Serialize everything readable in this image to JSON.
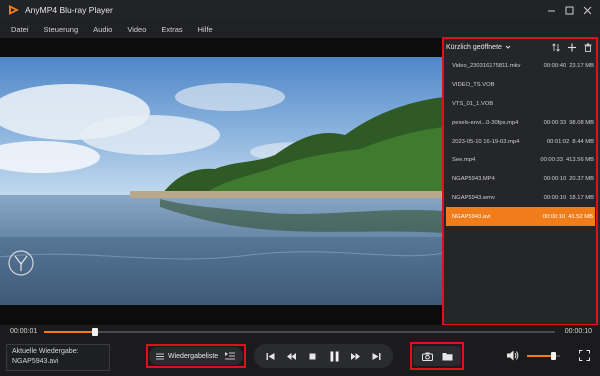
{
  "app": {
    "title": "AnyMP4 Blu-ray Player",
    "accent": "#f07d1a",
    "highlight": "#e0101c"
  },
  "window_controls": [
    "minimize-icon",
    "maximize-icon",
    "close-icon"
  ],
  "menu": [
    "Datei",
    "Steuerung",
    "Audio",
    "Video",
    "Extras",
    "Hilfe"
  ],
  "playlist": {
    "title": "Kürzlich geöffnete",
    "tools": [
      "sort-icon",
      "add-icon",
      "trash-icon"
    ],
    "items": [
      {
        "name": "Video_230316175811.mkv",
        "duration": "00:00:40",
        "size": "23.17 MB"
      },
      {
        "name": "VIDEO_TS.VOB",
        "duration": "",
        "size": ""
      },
      {
        "name": "VTS_01_1.VOB",
        "duration": "",
        "size": ""
      },
      {
        "name": "pexels-envi...0-30fps.mp4",
        "duration": "00:00:33",
        "size": "98.08 MB"
      },
      {
        "name": "2023-05-10 16-19-03.mp4",
        "duration": "00:01:02",
        "size": "8.44 MB"
      },
      {
        "name": "See.mp4",
        "duration": "00:00:33",
        "size": "413.56 MB"
      },
      {
        "name": "NGAP5943.MP4",
        "duration": "00:00:10",
        "size": "20.37 MB"
      },
      {
        "name": "NGAP5943.wmv",
        "duration": "00:00:10",
        "size": "18.17 MB"
      },
      {
        "name": "NGAP5943.avi",
        "duration": "00:00:10",
        "size": "41.52 MB",
        "active": true
      }
    ]
  },
  "progress": {
    "current": "00:00:01",
    "total": "00:00:10",
    "fraction": 0.1
  },
  "now_playing": {
    "label": "Aktuelle Wiedergabe:",
    "file": "NGAP5943.avi"
  },
  "playlist_button": {
    "label": "Wiedergabeliste"
  },
  "transport": [
    "skip-previous-icon",
    "rewind-icon",
    "stop-icon",
    "pause-icon",
    "fast-forward-icon",
    "skip-next-icon"
  ],
  "snapshot_tools": [
    "camera-icon",
    "folder-icon"
  ],
  "volume": {
    "level": 0.8
  }
}
